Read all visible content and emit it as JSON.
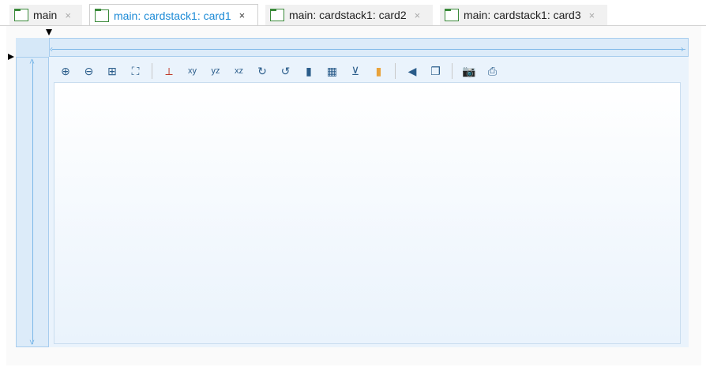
{
  "tabs": [
    {
      "label": "main",
      "active": false
    },
    {
      "label": "main: cardstack1: card1",
      "active": true
    },
    {
      "label": "main: cardstack1: card2",
      "active": false
    },
    {
      "label": "main: cardstack1: card3",
      "active": false
    }
  ],
  "close_glyph": "×",
  "toolbar": {
    "buttons": [
      {
        "name": "zoom-in-icon",
        "glyph": "⊕"
      },
      {
        "name": "zoom-out-icon",
        "glyph": "⊖"
      },
      {
        "name": "zoom-box-icon",
        "glyph": "⊞"
      },
      {
        "name": "zoom-extents-icon",
        "glyph": "⛶"
      },
      {
        "name": "axis-orientation-icon",
        "glyph": "⟂"
      },
      {
        "name": "xy-view-icon",
        "glyph": "xy"
      },
      {
        "name": "yz-view-icon",
        "glyph": "yz"
      },
      {
        "name": "xz-view-icon",
        "glyph": "xz"
      },
      {
        "name": "rotate-cw-icon",
        "glyph": "↻"
      },
      {
        "name": "rotate-ccw-icon",
        "glyph": "↺"
      },
      {
        "name": "scene-light-icon",
        "glyph": "▮"
      },
      {
        "name": "grid-icon",
        "glyph": "▦"
      },
      {
        "name": "show-axis-icon",
        "glyph": "⊻"
      },
      {
        "name": "color-legend-icon",
        "glyph": "▮"
      },
      {
        "name": "speaker-icon",
        "glyph": "◀"
      },
      {
        "name": "window-icon",
        "glyph": "❐"
      },
      {
        "name": "camera-icon",
        "glyph": "📷"
      },
      {
        "name": "print-icon",
        "glyph": "⎙"
      }
    ]
  }
}
